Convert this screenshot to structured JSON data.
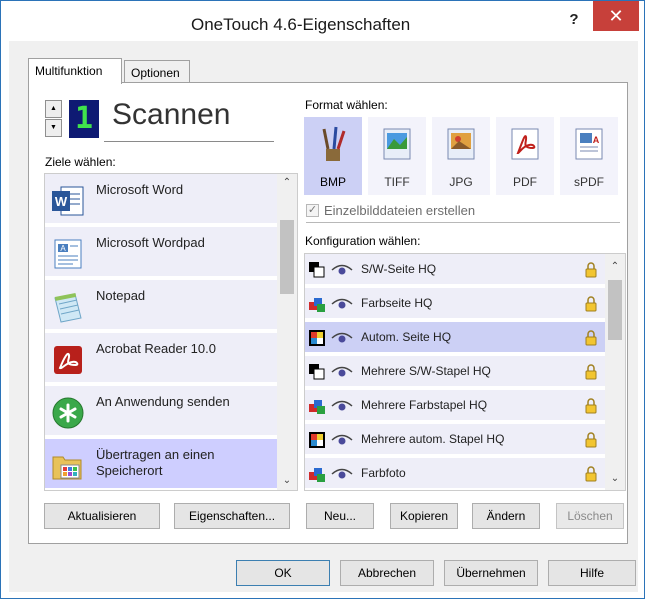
{
  "window": {
    "title": "OneTouch 4.6-Eigenschaften",
    "help": "?",
    "close": "✕"
  },
  "tabs": [
    {
      "label": "Multifunktion",
      "active": true
    },
    {
      "label": "Optionen",
      "active": false
    }
  ],
  "button_panel": {
    "number": "1",
    "name": "Scannen"
  },
  "destinations": {
    "label": "Ziele wählen:",
    "items": [
      {
        "label": "Microsoft Word",
        "icon": "word-icon"
      },
      {
        "label": "Microsoft Wordpad",
        "icon": "wordpad-icon"
      },
      {
        "label": "Notepad",
        "icon": "notepad-icon"
      },
      {
        "label": "Acrobat Reader 10.0",
        "icon": "acrobat-icon"
      },
      {
        "label": "An Anwendung senden",
        "icon": "send-app-icon"
      },
      {
        "label": "Übertragen an einen Speicherort",
        "icon": "folder-icon",
        "selected": true
      }
    ]
  },
  "format": {
    "label": "Format wählen:",
    "items": [
      {
        "label": "BMP",
        "icon": "bmp-icon",
        "selected": true
      },
      {
        "label": "TIFF",
        "icon": "tiff-icon"
      },
      {
        "label": "JPG",
        "icon": "jpg-icon"
      },
      {
        "label": "PDF",
        "icon": "pdf-icon"
      },
      {
        "label": "sPDF",
        "icon": "spdf-icon"
      }
    ],
    "single_file_label": "Einzelbilddateien erstellen",
    "single_file_checked": true
  },
  "configuration": {
    "label": "Konfiguration wählen:",
    "items": [
      {
        "label": "S/W-Seite HQ",
        "icon": "bw-icon"
      },
      {
        "label": "Farbseite HQ",
        "icon": "color-icon"
      },
      {
        "label": "Autom. Seite HQ",
        "icon": "auto-icon",
        "selected": true
      },
      {
        "label": "Mehrere S/W-Stapel HQ",
        "icon": "bw-icon"
      },
      {
        "label": "Mehrere Farbstapel HQ",
        "icon": "color-icon"
      },
      {
        "label": "Mehrere autom. Stapel HQ",
        "icon": "auto-icon"
      },
      {
        "label": "Farbfoto",
        "icon": "color-icon"
      }
    ]
  },
  "panel_buttons": {
    "refresh": "Aktualisieren",
    "properties": "Eigenschaften...",
    "new": "Neu...",
    "copy": "Kopieren",
    "edit": "Ändern",
    "delete": "Löschen"
  },
  "dialog_buttons": {
    "ok": "OK",
    "cancel": "Abbrechen",
    "apply": "Übernehmen",
    "help": "Hilfe"
  },
  "colors": {
    "selection": "#ccd0f5",
    "item_bg": "#eeeef8",
    "close_red": "#c7403a",
    "led_bg": "#0e1a73",
    "led_fg": "#40e34c"
  }
}
